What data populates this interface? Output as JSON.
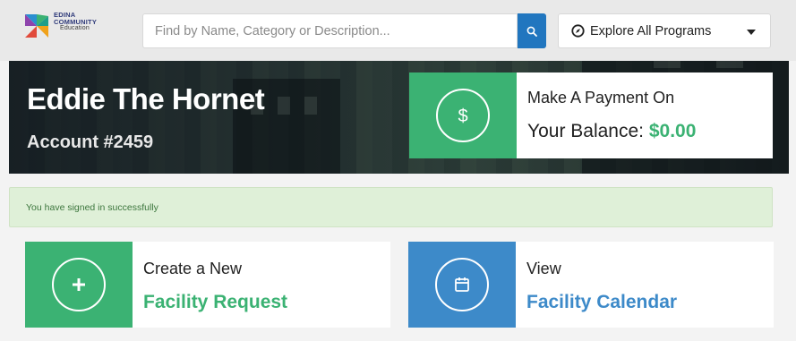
{
  "header": {
    "logo": {
      "line1": "EDINA",
      "line2": "COMMUNITY",
      "line3": "Education"
    },
    "search": {
      "placeholder": "Find by Name, Category or Description...",
      "value": ""
    },
    "explore": {
      "label": "Explore All Programs"
    }
  },
  "hero": {
    "name": "Eddie The Hornet",
    "account": "Account #2459"
  },
  "payment": {
    "line1": "Make A Payment On",
    "balance_label": "Your Balance:",
    "balance_value": "$0.00"
  },
  "alert": {
    "message": "You have signed in successfully"
  },
  "cards": {
    "create": {
      "line1": "Create a New",
      "line2": "Facility Request"
    },
    "view": {
      "line1": "View",
      "line2": "Facility Calendar"
    }
  },
  "colors": {
    "green": "#3bb273",
    "blue": "#3d8ac9",
    "search_button": "#2176bf",
    "alert_bg": "#dff0d8",
    "alert_text": "#3c763d"
  },
  "icons": {
    "search": "search-icon",
    "explore": "compass-icon",
    "dropdown": "chevron-down-icon",
    "payment": "dollar-icon",
    "create": "plus-icon",
    "view": "calendar-icon"
  }
}
